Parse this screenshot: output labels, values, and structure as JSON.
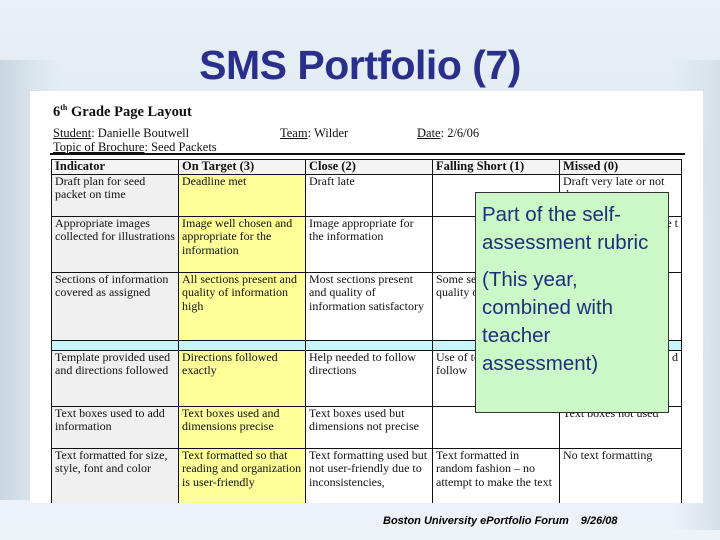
{
  "slide": {
    "title": "SMS Portfolio (7)"
  },
  "document": {
    "title_prefix": "6",
    "title_sup": "th",
    "title_rest": " Grade Page Layout",
    "student_label": "Student",
    "student_value": ": Danielle Boutwell",
    "team_label": "Team",
    "team_value": ":  Wilder",
    "date_label": "Date",
    "date_value": ": 2/6/06",
    "topic_label": "Topic of Brochure",
    "topic_value": ": Seed Packets"
  },
  "rubric": {
    "headers": [
      "Indicator",
      "On Target (3)",
      "Close (2)",
      "Falling Short (1)",
      "Missed (0)"
    ],
    "rows": [
      {
        "indicator": "Draft plan for seed packet on time",
        "on_target": "Deadline met",
        "close": "Draft late",
        "falling_short": "",
        "missed": "Draft very late or not done"
      },
      {
        "indicator": "Appropriate images collected for illustrations",
        "on_target": "Image well chosen and appropriate for the information",
        "close": "Image appropriate for the information",
        "falling_short": "",
        "missed": "e\nt"
      },
      {
        "indicator": "Sections of information covered as assigned",
        "on_target": "All sections present and quality of information high",
        "close": "Most sections present and quality of information satisfactory",
        "falling_short": "Some sections present, quality of information",
        "missed": ""
      },
      {
        "indicator": "Template provided used and directions followed",
        "on_target": "Directions followed exactly",
        "close": "Help needed to follow directions",
        "falling_short": "Use of template did not follow",
        "missed": "d"
      },
      {
        "indicator": "Text boxes used to add information",
        "on_target": "Text boxes used and dimensions precise",
        "close": "Text boxes used but dimensions not precise",
        "falling_short": "",
        "missed": "Text boxes not used"
      },
      {
        "indicator": "Text formatted for size, style, font and color",
        "on_target": "Text formatted so that reading and organization is user-friendly",
        "close": "Text formatting used but not user-friendly due to inconsistencies,",
        "falling_short": "Text formatted in random fashion – no attempt to make the text",
        "missed": "No text formatting"
      }
    ]
  },
  "callout": {
    "line1": "Part of the self-assessment rubric",
    "line2": "(This year, combined with teacher assessment)"
  },
  "footer": {
    "text": "Boston University ePortfolio Forum",
    "date": "9/26/08"
  },
  "colors": {
    "title": "#2b2f8c",
    "on_target_fill": "#ffff99",
    "callout_fill": "#ccf7c6",
    "callout_text": "#1f2f7a",
    "spacer_fill": "#c8f4fb"
  }
}
